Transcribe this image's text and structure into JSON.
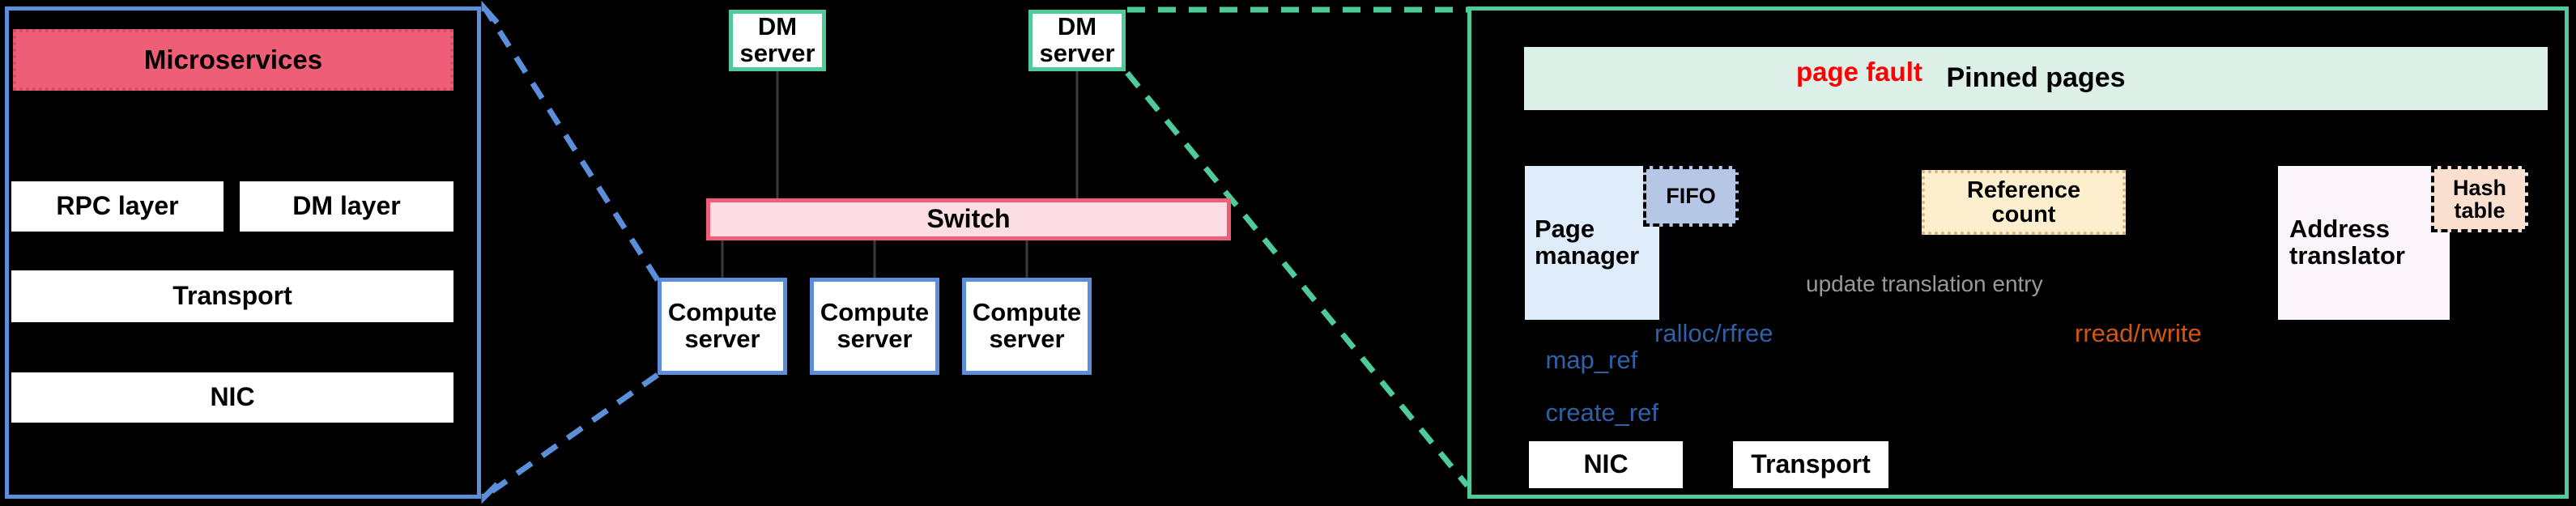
{
  "diagram": {
    "title": "Disaggregated memory system architecture",
    "panels": {
      "client": {
        "name": "compute-server-internals",
        "border_color": "#5B8FD9",
        "blocks": [
          {
            "id": "microservices",
            "label": "Microservices",
            "fill": "#EF5E77",
            "border": "#D94B66",
            "style": "dotted"
          },
          {
            "id": "rpc_layer",
            "label": "RPC layer",
            "fill": "#FFFFFF",
            "style": "solid"
          },
          {
            "id": "dm_layer",
            "label": "DM layer",
            "fill": "#FFFFFF",
            "style": "solid"
          },
          {
            "id": "transport",
            "label": "Transport",
            "fill": "#FFFFFF",
            "style": "solid"
          },
          {
            "id": "nic",
            "label": "NIC",
            "fill": "#FFFFFF",
            "style": "solid"
          }
        ]
      },
      "cluster": {
        "name": "rack-topology",
        "dm_servers": [
          {
            "line1": "DM",
            "line2": "server",
            "border": "#4ECB99"
          },
          {
            "line1": "DM",
            "line2": "server",
            "border": "#4ECB99"
          }
        ],
        "switch": {
          "label": "Switch",
          "fill": "#FCDDE3",
          "border": "#EF5E77"
        },
        "compute_servers": [
          {
            "line1": "Compute",
            "line2": "server",
            "border": "#5B8FD9"
          },
          {
            "line1": "Compute",
            "line2": "server",
            "border": "#5B8FD9"
          },
          {
            "line1": "Compute",
            "line2": "server",
            "border": "#5B8FD9"
          }
        ]
      },
      "dm_server": {
        "name": "dm-server-internals",
        "border_color": "#4ECB99",
        "blocks": [
          {
            "id": "pinned_pages",
            "label": "Pinned pages",
            "fill": "#DCF0E8",
            "style": "solid"
          },
          {
            "id": "page_manager",
            "line1": "Page",
            "line2": "manager",
            "fill": "#DEEDF9",
            "style": "solid"
          },
          {
            "id": "fifo",
            "label": "FIFO",
            "fill": "#B6C7E5",
            "border": "#000000",
            "style": "dashed"
          },
          {
            "id": "reference_count",
            "line1": "Reference",
            "line2": "count",
            "fill": "#FDEFCE",
            "border": "#D9B775",
            "style": "dotted"
          },
          {
            "id": "address_translator",
            "line1": "Address",
            "line2": "translator",
            "fill": "#FCF5FC",
            "style": "solid"
          },
          {
            "id": "hash_table",
            "line1": "Hash",
            "line2": "table",
            "fill": "#FBE0D0",
            "border": "#000000",
            "style": "dashed"
          },
          {
            "id": "nic",
            "label": "NIC",
            "fill": "#FFFFFF",
            "style": "solid"
          },
          {
            "id": "transport",
            "label": "Transport",
            "fill": "#FFFFFF",
            "style": "solid"
          }
        ],
        "arrows": [
          {
            "id": "page_fault",
            "label": "page fault",
            "color": "#FF0000",
            "from": "address_translator",
            "to": "page_manager"
          },
          {
            "id": "update_translation_entry",
            "label": "update translation entry",
            "color": "#808080",
            "from": "page_manager",
            "to": "address_translator"
          },
          {
            "id": "map_ref",
            "label": "map_ref\ncreate_ref",
            "color": "#3060A8",
            "from": "nic",
            "to": "page_manager"
          },
          {
            "id": "ralloc_rfree",
            "label": "ralloc/rfree",
            "color": "#3060A8",
            "from": "transport",
            "to": "page_manager"
          },
          {
            "id": "rread_rwrite",
            "label": "rread/rwrite",
            "color": "#D2560E",
            "from": "transport",
            "to": "address_translator"
          },
          {
            "id": "pinned_access",
            "label": "",
            "color": "#C79A10",
            "from": "address_translator",
            "to": "pinned_pages"
          }
        ]
      }
    },
    "callouts": [
      {
        "id": "client-callout",
        "color": "#5B8FD9",
        "style": "dashed",
        "from": "compute_server_1",
        "to": "client_panel"
      },
      {
        "id": "dm-callout",
        "color": "#4ECB99",
        "style": "dashed",
        "from": "dm_server_2",
        "to": "dm_server_panel"
      }
    ]
  },
  "left_panel": {
    "microservices": "Microservices",
    "rpc_layer": "RPC layer",
    "dm_layer": "DM layer",
    "transport": "Transport",
    "nic": "NIC"
  },
  "middle": {
    "dm_server_1_line1": "DM",
    "dm_server_1_line2": "server",
    "dm_server_2_line1": "DM",
    "dm_server_2_line2": "server",
    "switch": "Switch",
    "compute_1_line1": "Compute",
    "compute_1_line2": "server",
    "compute_2_line1": "Compute",
    "compute_2_line2": "server",
    "compute_3_line1": "Compute",
    "compute_3_line2": "server"
  },
  "right_panel": {
    "pinned_pages": "Pinned pages",
    "page_manager_line1": "Page",
    "page_manager_line2": "manager",
    "fifo": "FIFO",
    "reference_count_line1": "Reference",
    "reference_count_line2": "count",
    "address_translator_line1": "Address",
    "address_translator_line2": "translator",
    "hash_table_line1": "Hash",
    "hash_table_line2": "table",
    "nic": "NIC",
    "transport": "Transport",
    "label_page_fault": "page fault",
    "label_update_entry": "update translation entry",
    "label_map_ref_line1": "map_ref",
    "label_map_ref_line2": "create_ref",
    "label_ralloc_rfree": "ralloc/rfree",
    "label_rread_rwrite": "rread/rwrite"
  },
  "colors": {
    "blue_border": "#5B8FD9",
    "green_border": "#4ECB99",
    "pink_fill": "#EF5E77",
    "switch_fill": "#FCDDE3",
    "pinned_fill": "#DCF0E8",
    "page_manager_fill": "#DEEDF9",
    "fifo_fill": "#B6C7E5",
    "refcount_fill": "#FDEFCE",
    "translator_fill": "#FCF5FC",
    "hash_fill": "#FBE0D0",
    "red_arrow": "#FF0000",
    "gray_arrow": "#808080",
    "blue_arrow": "#3060A8",
    "gold_arrow": "#C79A10",
    "orange_text": "#D2560E"
  }
}
